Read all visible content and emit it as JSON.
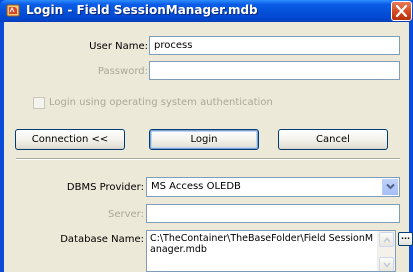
{
  "window": {
    "title": "Login - Field SessionManager.mdb",
    "icon": "access-db-icon",
    "close_icon": "close-icon"
  },
  "form": {
    "user_name_label": "User Name:",
    "user_name_value": "process",
    "password_label": "Password:",
    "password_value": "",
    "os_auth_label": "Login using operating system authentication",
    "os_auth_checked": false
  },
  "buttons": {
    "connection": "Connection <<",
    "login": "Login",
    "cancel": "Cancel"
  },
  "connection": {
    "dbms_label": "DBMS Provider:",
    "dbms_value": "MS Access OLEDB",
    "server_label": "Server:",
    "server_value": "",
    "database_label": "Database Name:",
    "database_value": "C:\\TheContainer\\TheBaseFolder\\Field SessionManager.mdb",
    "browse_label": "..."
  },
  "colors": {
    "titlebar": "#0a5ce6",
    "dialog_bg": "#ece9d8",
    "close_red": "#d34519"
  }
}
